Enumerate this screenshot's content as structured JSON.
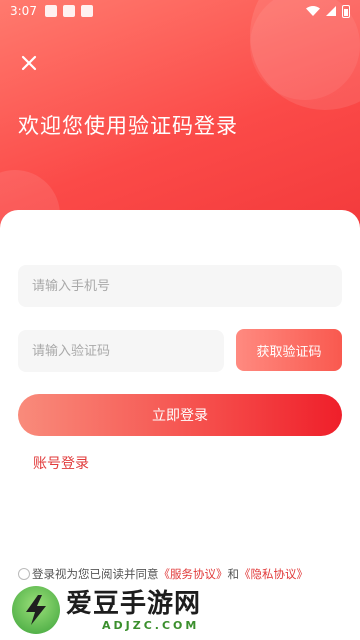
{
  "status_bar": {
    "time": "3:07"
  },
  "header": {
    "close_icon": "close-icon",
    "title": "欢迎您使用验证码登录"
  },
  "form": {
    "phone_placeholder": "请输入手机号",
    "code_placeholder": "请输入验证码",
    "get_code_label": "获取验证码",
    "login_label": "立即登录",
    "account_login_label": "账号登录"
  },
  "agreement": {
    "prefix": "登录视为您已阅读并同意",
    "service_link": "《服务协议》",
    "and": "和",
    "privacy_link": "《隐私协议》"
  },
  "watermark": {
    "title": "爱豆手游网",
    "url": "ADJZC.COM"
  },
  "colors": {
    "accent": "#f54c4a",
    "link": "#e13a3a"
  }
}
